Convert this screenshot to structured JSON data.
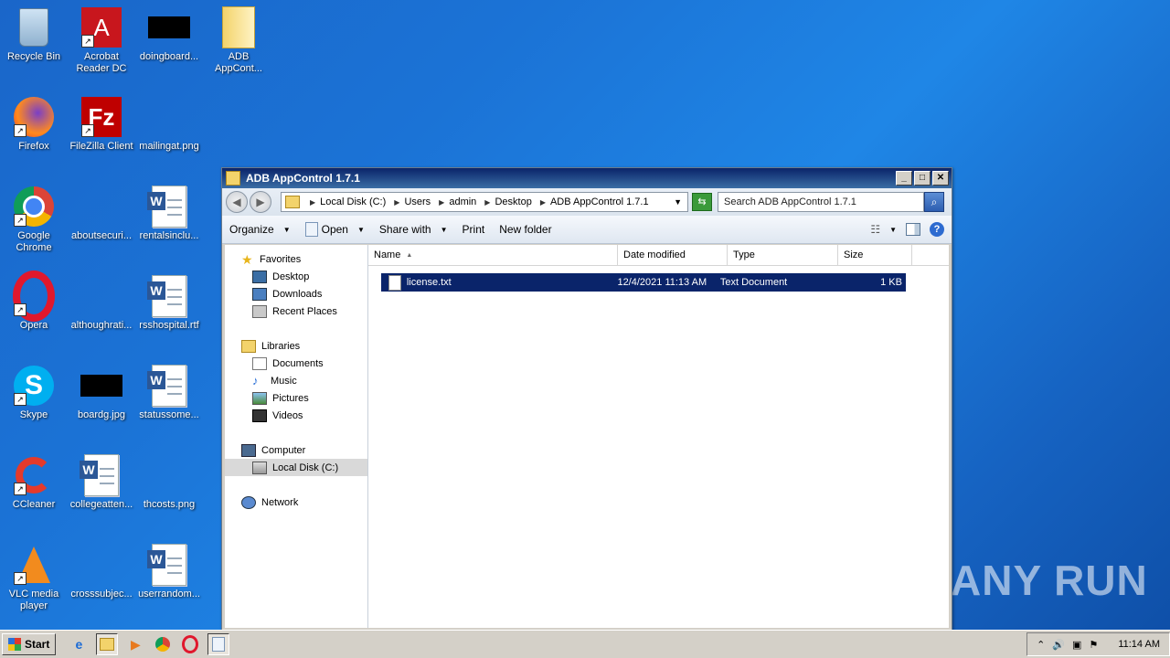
{
  "desktop": {
    "icons": [
      {
        "label": "Recycle Bin"
      },
      {
        "label": "Acrobat Reader DC"
      },
      {
        "label": "doingboard..."
      },
      {
        "label": "ADB AppCont..."
      },
      {
        "label": "Firefox"
      },
      {
        "label": "FileZilla Client"
      },
      {
        "label": "mailingat.png"
      },
      {
        "label": "Google Chrome"
      },
      {
        "label": "aboutsecuri..."
      },
      {
        "label": "rentalsinclu..."
      },
      {
        "label": "Opera"
      },
      {
        "label": "althoughrati..."
      },
      {
        "label": "rsshospital.rtf"
      },
      {
        "label": "Skype"
      },
      {
        "label": "boardg.jpg"
      },
      {
        "label": "statussome..."
      },
      {
        "label": "CCleaner"
      },
      {
        "label": "collegeatten..."
      },
      {
        "label": "thcosts.png"
      },
      {
        "label": "VLC media player"
      },
      {
        "label": "crosssubjec..."
      },
      {
        "label": "userrandom..."
      }
    ],
    "watermark": "ANY RUN"
  },
  "window": {
    "title": "ADB AppControl 1.7.1",
    "address": {
      "crumbs": [
        "Local Disk (C:)",
        "Users",
        "admin",
        "Desktop",
        "ADB AppControl 1.7.1"
      ]
    },
    "search_placeholder": "Search ADB AppControl 1.7.1",
    "toolbar": {
      "organize": "Organize",
      "open": "Open",
      "share_with": "Share with",
      "print": "Print",
      "new_folder": "New folder"
    },
    "nav": {
      "favorites": "Favorites",
      "fav_items": [
        "Desktop",
        "Downloads",
        "Recent Places"
      ],
      "libraries": "Libraries",
      "lib_items": [
        "Documents",
        "Music",
        "Pictures",
        "Videos"
      ],
      "computer": "Computer",
      "comp_items": [
        "Local Disk (C:)"
      ],
      "network": "Network"
    },
    "columns": [
      "Name",
      "Date modified",
      "Type",
      "Size"
    ],
    "files": [
      {
        "name": "license.txt",
        "date": "12/4/2021 11:13 AM",
        "type": "Text Document",
        "size": "1 KB"
      }
    ]
  },
  "taskbar": {
    "start": "Start",
    "clock": "11:14 AM"
  }
}
